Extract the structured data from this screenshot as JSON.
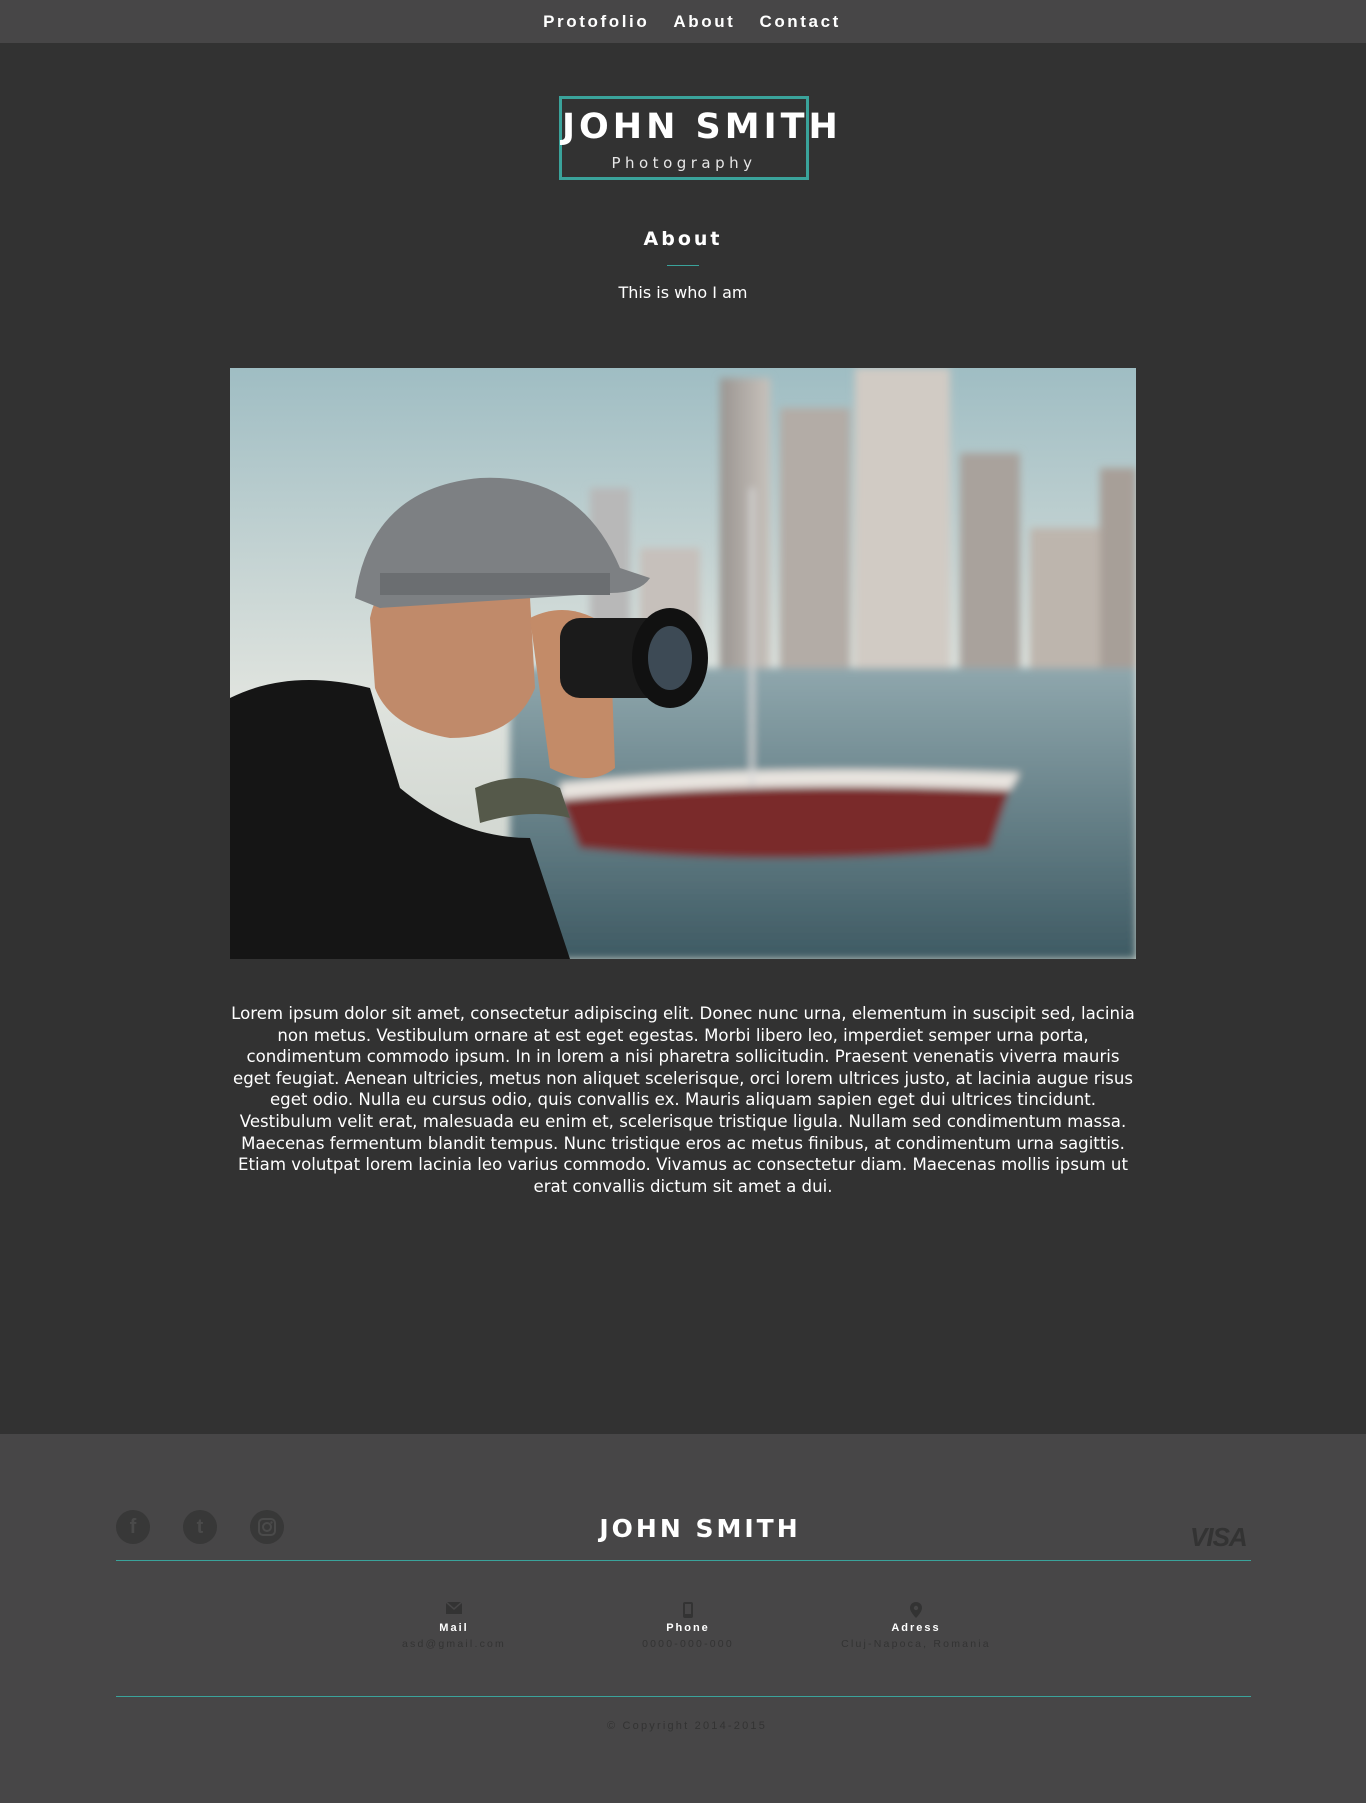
{
  "nav": {
    "items": [
      {
        "label": "Protofolio"
      },
      {
        "label": "About"
      },
      {
        "label": "Contact"
      }
    ]
  },
  "logo": {
    "name": "JOHN SMITH",
    "tagline": "Photography",
    "border_color": "#3aa39b"
  },
  "about": {
    "title": "About",
    "subtitle": "This is who I am",
    "photo_icon": "photographer-photo",
    "body": "Lorem ipsum dolor sit amet, consectetur adipiscing elit. Donec nunc urna, elementum in suscipit sed, lacinia non metus. Vestibulum ornare at est eget egestas. Morbi libero leo, imperdiet semper urna porta, condimentum commodo ipsum. In in lorem a nisi pharetra sollicitudin. Praesent venenatis viverra mauris eget feugiat. Aenean ultricies, metus non aliquet scelerisque, orci lorem ultrices justo, at lacinia augue risus eget odio. Nulla eu cursus odio, quis convallis ex. Mauris aliquam sapien eget dui ultrices tincidunt. Vestibulum velit erat, malesuada eu enim et, scelerisque tristique ligula. Nullam sed condimentum massa. Maecenas fermentum blandit tempus. Nunc tristique eros ac metus finibus, at condimentum urna sagittis. Etiam volutpat lorem lacinia leo varius commodo. Vivamus ac consectetur diam. Maecenas mollis ipsum ut erat convallis dictum sit amet a dui."
  },
  "footer": {
    "social": [
      {
        "icon": "facebook-icon",
        "glyph": "f"
      },
      {
        "icon": "tumblr-icon",
        "glyph": "t"
      },
      {
        "icon": "instagram-icon",
        "glyph": ""
      }
    ],
    "name": "JOHN SMITH",
    "payment": "VISA",
    "contacts": [
      {
        "icon": "mail-icon",
        "label": "Mail",
        "value": "asd@gmail.com"
      },
      {
        "icon": "phone-icon",
        "label": "Phone",
        "value": "0000-000-000"
      },
      {
        "icon": "location-pin-icon",
        "label": "Adress",
        "value": "Cluj-Napoca, Romania"
      }
    ],
    "copyright": "© Copyright 2014-2015"
  },
  "colors": {
    "background": "#323232",
    "nav_background": "#474647",
    "footer_background": "#474647",
    "accent": "#3aa39b",
    "muted_text": "#333333"
  }
}
